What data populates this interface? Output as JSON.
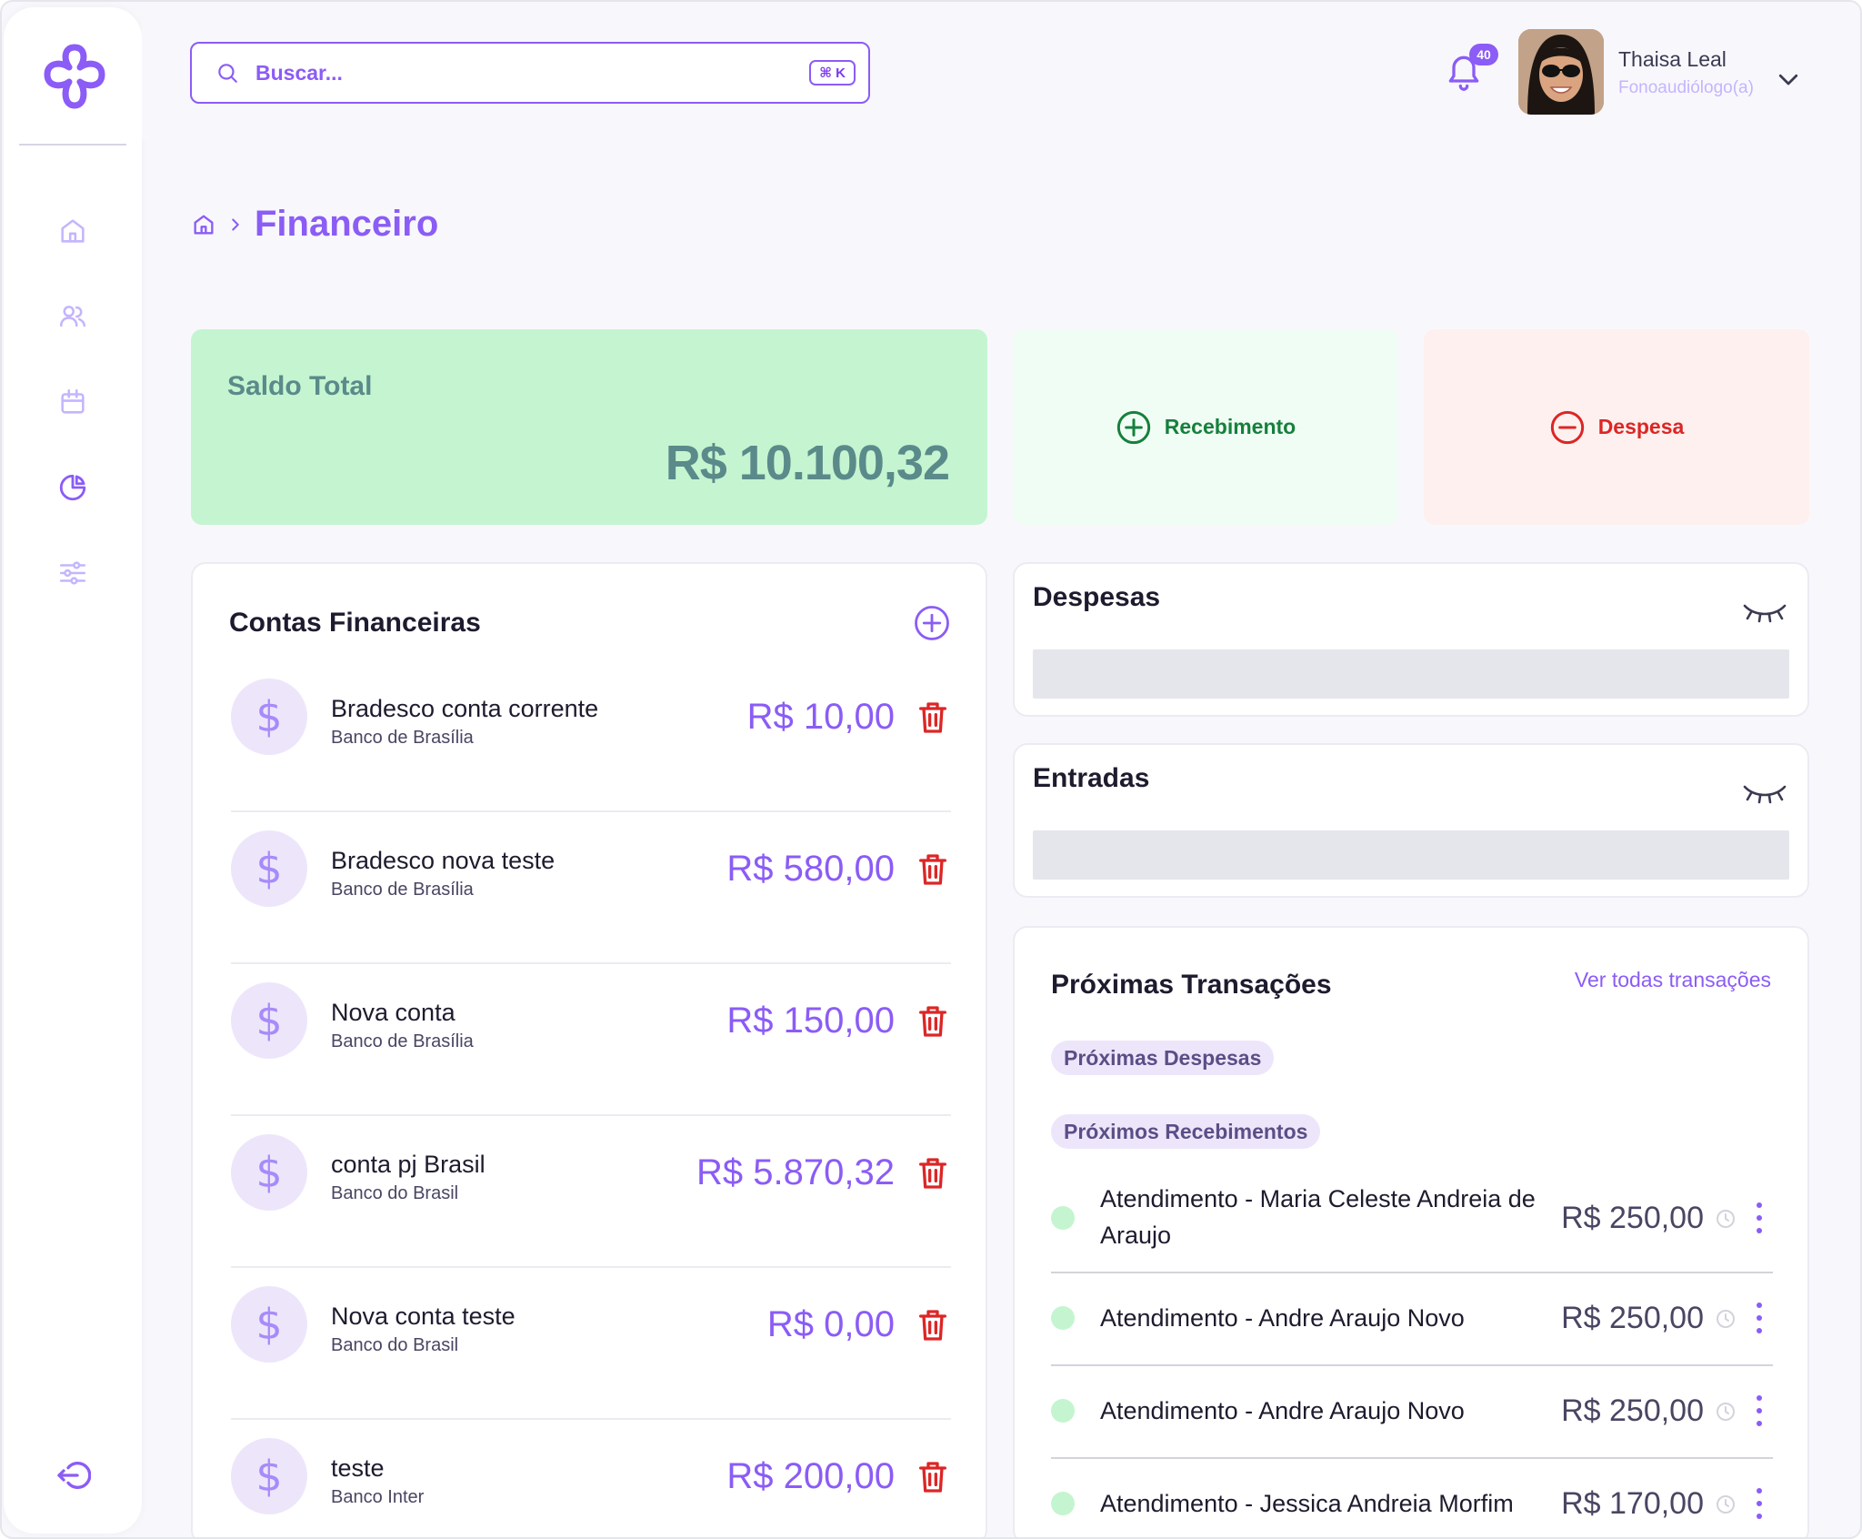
{
  "colors": {
    "accent": "#8b5cf6",
    "saldo_bg": "#c4f5d0",
    "saldo_text": "#5b8a8a",
    "income": "#16803c",
    "expense": "#dc2626"
  },
  "search": {
    "placeholder": "Buscar...",
    "shortcut": "⌘ K"
  },
  "notifications": {
    "count": "40"
  },
  "user": {
    "name": "Thaisa Leal",
    "role": "Fonoaudiólogo(a)"
  },
  "sidebar": {
    "items": [
      {
        "name": "home",
        "icon": "home-icon"
      },
      {
        "name": "patients",
        "icon": "users-icon"
      },
      {
        "name": "calendar",
        "icon": "calendar-icon"
      },
      {
        "name": "financeiro",
        "icon": "pie-chart-icon",
        "active": true
      },
      {
        "name": "settings",
        "icon": "sliders-icon"
      }
    ],
    "logout_icon": "logout-icon"
  },
  "breadcrumb": {
    "title": "Financeiro"
  },
  "saldo": {
    "label": "Saldo Total",
    "value": "R$ 10.100,32"
  },
  "actions": {
    "recebimento": "Recebimento",
    "despesa": "Despesa"
  },
  "contas": {
    "title": "Contas Financeiras",
    "items": [
      {
        "name": "Bradesco conta corrente",
        "bank": "Banco de Brasília",
        "value": "R$ 10,00"
      },
      {
        "name": "Bradesco nova teste",
        "bank": "Banco de Brasília",
        "value": "R$ 580,00"
      },
      {
        "name": "Nova conta",
        "bank": "Banco de Brasília",
        "value": "R$ 150,00"
      },
      {
        "name": "conta pj Brasil",
        "bank": "Banco do Brasil",
        "value": "R$ 5.870,32"
      },
      {
        "name": "Nova conta teste",
        "bank": "Banco do Brasil",
        "value": "R$ 0,00"
      },
      {
        "name": "teste",
        "bank": "Banco Inter",
        "value": "R$ 200,00"
      }
    ]
  },
  "despesas_panel": {
    "title": "Despesas"
  },
  "entradas_panel": {
    "title": "Entradas"
  },
  "transacoes": {
    "title": "Próximas Transações",
    "link": "Ver todas transações",
    "tab_despesas": "Próximas Despesas",
    "tab_recebimentos": "Próximos Recebimentos",
    "items": [
      {
        "desc": "Atendimento - Maria Celeste Andreia de Araujo",
        "value": "R$ 250,00"
      },
      {
        "desc": "Atendimento - Andre Araujo Novo",
        "value": "R$ 250,00"
      },
      {
        "desc": "Atendimento - Andre Araujo Novo",
        "value": "R$ 250,00"
      },
      {
        "desc": "Atendimento - Jessica Andreia Morfim",
        "value": "R$ 170,00"
      }
    ]
  }
}
